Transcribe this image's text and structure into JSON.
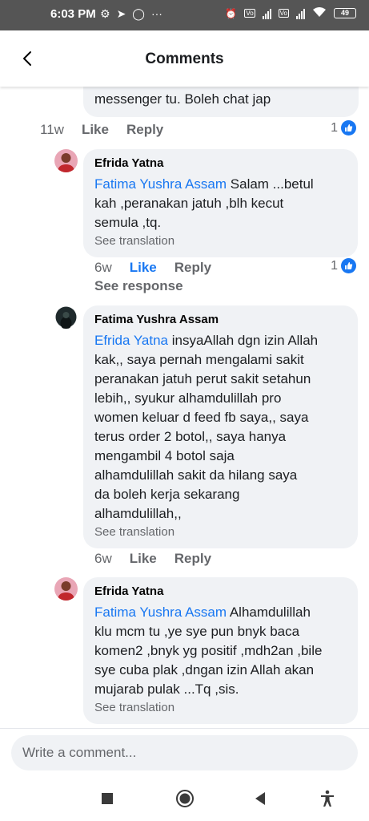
{
  "status_bar": {
    "time": "6:03 PM",
    "battery": "49"
  },
  "header": {
    "title": "Comments"
  },
  "comments": [
    {
      "author": "",
      "text": "messenger tu. Boleh chat jap",
      "time": "11w",
      "like_label": "Like",
      "reply_label": "Reply",
      "reaction_count": "1"
    },
    {
      "author": "Efrida Yatna",
      "mention": "Fatima Yushra Assam",
      "text": " Salam ...betul\nkah ,peranakan jatuh ,blh kecut\nsemula ,tq.",
      "see_translation": "See translation",
      "time": "6w",
      "like_label": "Like",
      "reply_label": "Reply",
      "reaction_count": "1",
      "see_response": "See response"
    },
    {
      "author": "Fatima Yushra Assam",
      "mention": "Efrida Yatna",
      "text": " insyaAllah dgn izin Allah\nkak,,  saya pernah mengalami sakit\nperanakan jatuh perut  sakit  setahun\nlebih,,  syukur alhamdulillah  pro\nwomen  keluar  d feed fb saya,,  saya\nterus order  2 botol,,  saya  hanya\nmengambil  4 botol  saja\nalhamdulillah  sakit  da hilang  saya\nda boleh kerja  sekarang\nalhamdulillah,,",
      "see_translation": "See translation",
      "time": "6w",
      "like_label": "Like",
      "reply_label": "Reply"
    },
    {
      "author": "Efrida Yatna",
      "mention": "Fatima Yushra Assam",
      "text": " Alhamdulillah\nklu mcm tu ,ye sye pun bnyk baca\nkomen2 ,bnyk yg positif ,mdh2an ,bile\nsye cuba plak ,dngan izin Allah akan\nmujarab pulak ...Tq ,sis.",
      "see_translation": "See translation"
    }
  ],
  "comment_box": {
    "placeholder": "Write a comment..."
  },
  "colors": {
    "accent": "#1877f2",
    "bubble": "#f0f2f5",
    "secondary_text": "#65676b",
    "status_bar": "#555555"
  },
  "icons": {
    "back": "chevron-left-icon",
    "like_reaction": "thumbs-up-icon",
    "nav": [
      "recents-square-icon",
      "home-circle-icon",
      "back-triangle-icon",
      "accessibility-icon"
    ]
  }
}
